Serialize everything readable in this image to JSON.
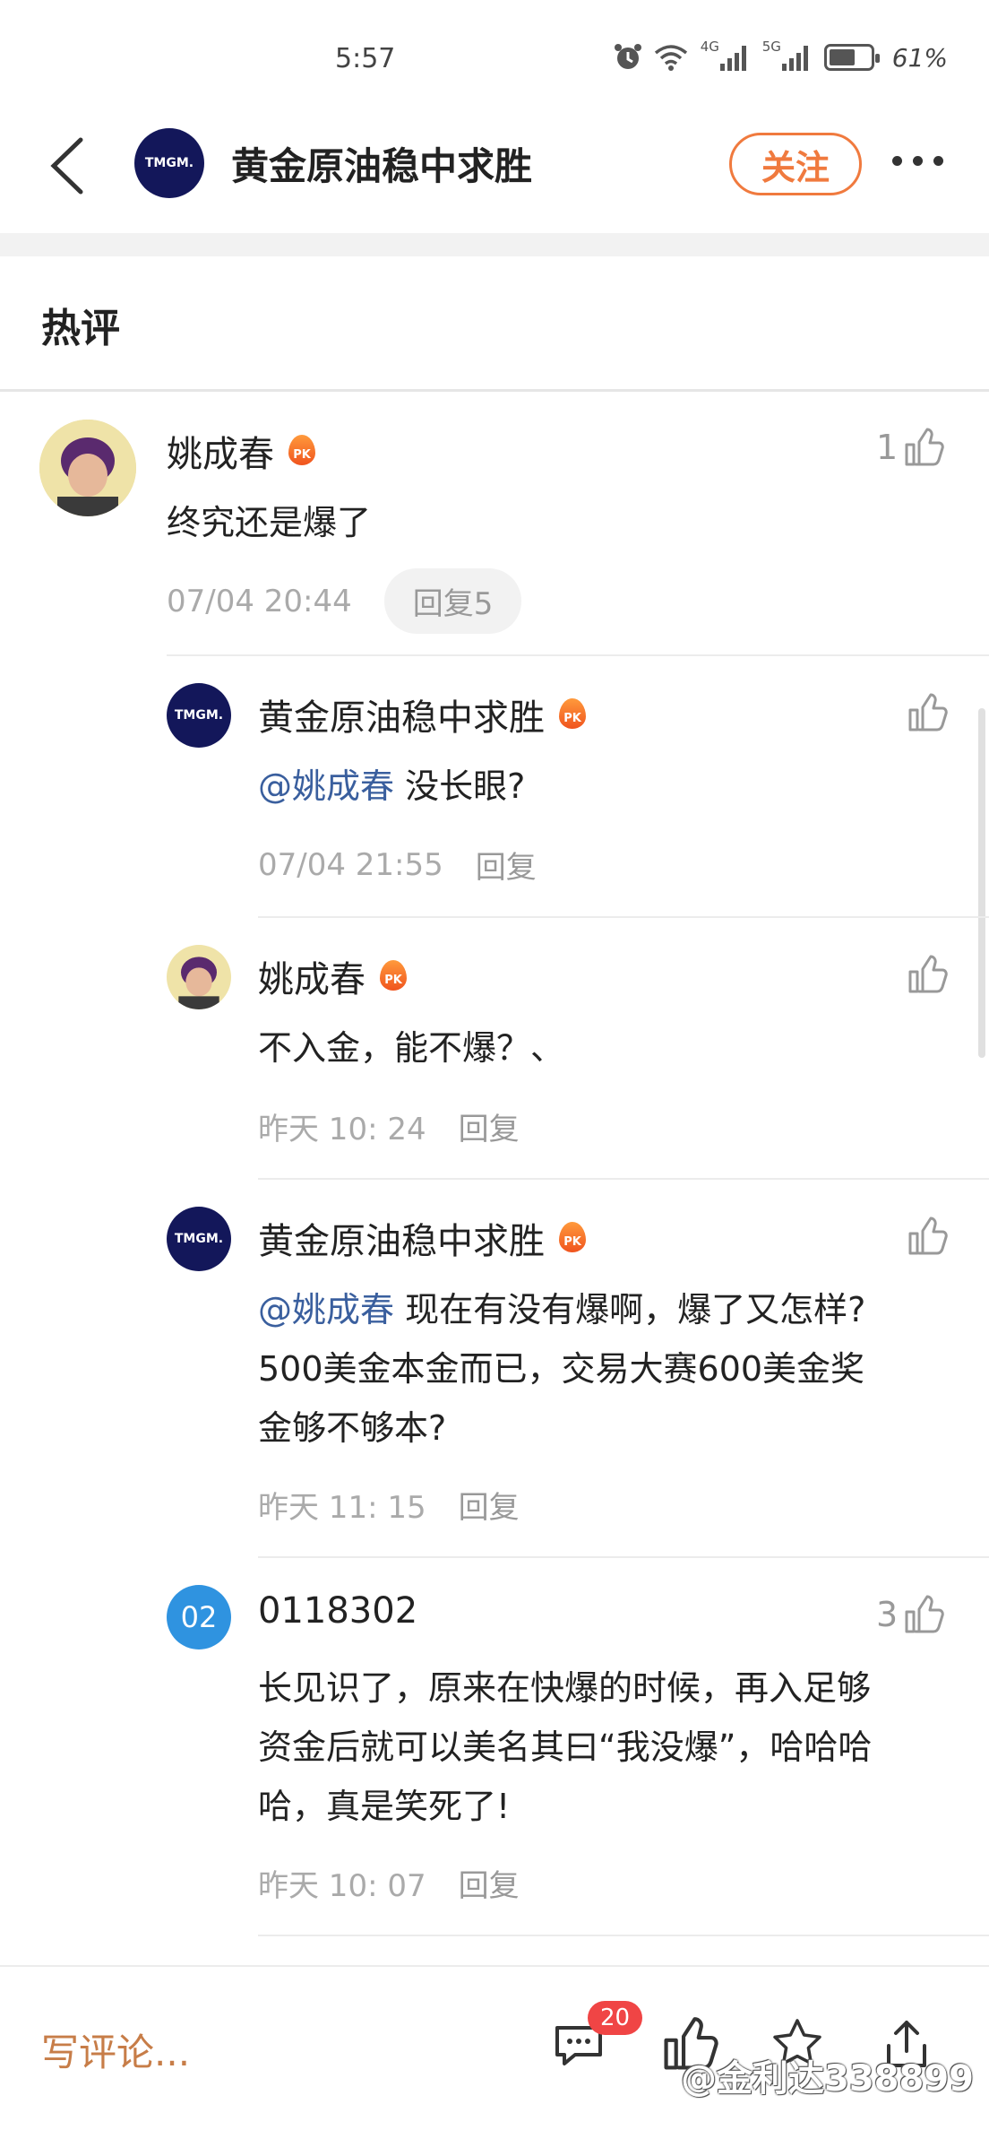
{
  "status": {
    "time": "5:57",
    "net1": "4G",
    "net2": "5G",
    "battery": "61%",
    "battery_level": 0.61
  },
  "header": {
    "title": "黄金原油稳中求胜",
    "follow_label": "关注"
  },
  "section": {
    "title": "热评"
  },
  "main_comment": {
    "author": "姚成春",
    "text": "终究还是爆了",
    "time": "07/04 20:44",
    "reply_label": "回复5",
    "likes": "1"
  },
  "replies": [
    {
      "author": "黄金原油稳中求胜",
      "mention": "@姚成春",
      "text": " 没长眼?",
      "time": "07/04 21:55",
      "reply_label": "回复",
      "likes": ""
    },
    {
      "author": "姚成春",
      "mention": "",
      "text": "不入金，能不爆？、",
      "time": "昨天 10: 24",
      "reply_label": "回复",
      "likes": ""
    },
    {
      "author": "黄金原油稳中求胜",
      "mention": "@姚成春",
      "text": " 现在有没有爆啊，爆了又怎样?",
      "text2": "500美金本金而已，交易大赛600美金奖",
      "text3": "金够不够本?",
      "time": "昨天 11: 15",
      "reply_label": "回复",
      "likes": ""
    },
    {
      "author": "0118302",
      "avatar_text": "02",
      "text": "长见识了，原来在快爆的时候，再入足够",
      "text2": "资金后就可以美名其曰“我没爆”，哈哈哈",
      "text3": "哈，真是笑死了!",
      "time": "昨天 10: 07",
      "reply_label": "回复",
      "likes": "3"
    }
  ],
  "avatar_logo": "TMGM.",
  "pk_label": "PK",
  "bottom": {
    "write_placeholder": "写评论...",
    "comment_count": "20",
    "watermark": "@金利达338899"
  }
}
